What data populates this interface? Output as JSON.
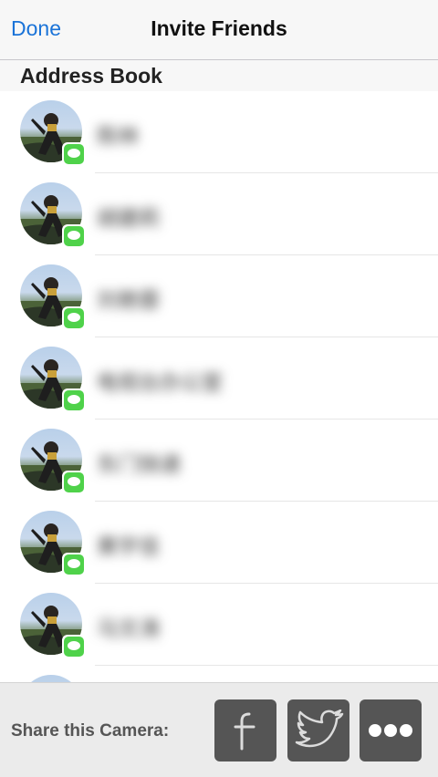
{
  "navbar": {
    "done_label": "Done",
    "title": "Invite Friends"
  },
  "section": {
    "title": "Address Book"
  },
  "contacts": [
    {
      "name": "陈林"
    },
    {
      "name": "胡建莉"
    },
    {
      "name": "刘艳蓉"
    },
    {
      "name": "电视台办公室"
    },
    {
      "name": "东门快递"
    },
    {
      "name": "黄宇佳"
    },
    {
      "name": "马文涛"
    }
  ],
  "footer": {
    "share_label": "Share this Camera:",
    "buttons": [
      {
        "icon": "facebook-icon"
      },
      {
        "icon": "twitter-icon"
      },
      {
        "icon": "more-icon"
      }
    ]
  },
  "colors": {
    "accent": "#1a73d8",
    "badge_green": "#4fd24a",
    "share_button": "#555555"
  }
}
